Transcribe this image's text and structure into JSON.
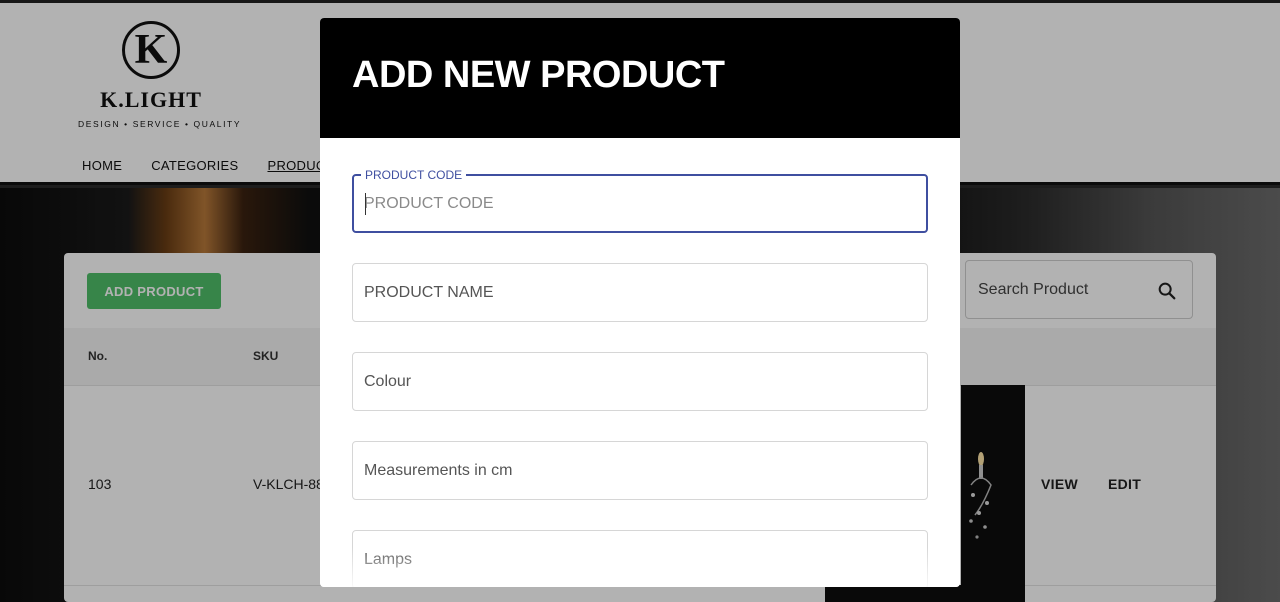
{
  "brand": {
    "logo_letter": "K",
    "name": "K.LIGHT",
    "tagline": "DESIGN • SERVICE • QUALITY"
  },
  "nav": {
    "items": [
      "HOME",
      "CATEGORIES",
      "PRODUCT"
    ],
    "active": "PRODUCT"
  },
  "toolbar": {
    "add_label": "ADD PRODUCT",
    "search_placeholder": "Search Product"
  },
  "table": {
    "columns": [
      "No.",
      "SKU"
    ],
    "rows": [
      {
        "no": "103",
        "sku": "V-KLCH-88",
        "view_label": "VIEW",
        "edit_label": "EDIT"
      }
    ]
  },
  "modal": {
    "title": "ADD NEW PRODUCT",
    "fields": [
      {
        "label": "PRODUCT CODE",
        "placeholder": "PRODUCT CODE",
        "value": ""
      },
      {
        "placeholder": "PRODUCT NAME",
        "value": ""
      },
      {
        "placeholder": "Colour",
        "value": ""
      },
      {
        "placeholder": "Measurements in cm",
        "value": ""
      },
      {
        "placeholder": "Lamps",
        "value": ""
      }
    ]
  },
  "colors": {
    "accent": "#3f4fa0",
    "add_button": "#4fbf69",
    "modal_header": "#000000"
  },
  "icons": {
    "search": "search-icon"
  }
}
